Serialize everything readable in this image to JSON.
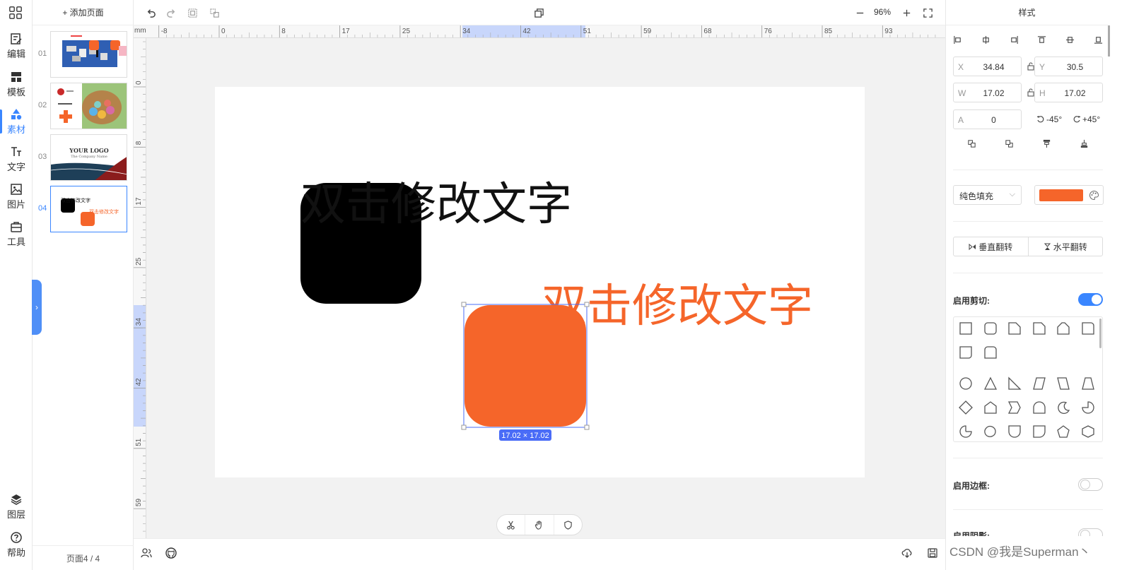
{
  "left_nav": {
    "items": [
      {
        "label": "编辑",
        "icon": "edit-icon"
      },
      {
        "label": "模板",
        "icon": "template-icon"
      },
      {
        "label": "素材",
        "icon": "shapes-icon",
        "active": true
      },
      {
        "label": "文字",
        "icon": "text-icon"
      },
      {
        "label": "图片",
        "icon": "image-icon"
      },
      {
        "label": "工具",
        "icon": "toolbox-icon"
      }
    ],
    "bottom_items": [
      {
        "label": "图层",
        "icon": "layers-icon"
      },
      {
        "label": "帮助",
        "icon": "help-icon"
      }
    ]
  },
  "pages_panel": {
    "add_page_label": "+ 添加页面",
    "pages": [
      {
        "num": "01"
      },
      {
        "num": "02"
      },
      {
        "num": "03",
        "logo_text": "YOUR LOGO",
        "company_text": "The Company Name"
      },
      {
        "num": "04",
        "active": true,
        "text_black": "双击修改文字",
        "text_orange": "双击修改文字"
      }
    ],
    "footer": "页面4 / 4"
  },
  "toolbar": {
    "zoom": "96%",
    "icons": [
      "undo-icon",
      "redo-icon",
      "group-icon",
      "ungroup-icon",
      "copy-icon",
      "zoom-out-icon",
      "zoom-in-icon",
      "fullscreen-icon"
    ]
  },
  "ruler": {
    "unit": "mm",
    "h_ticks": [
      "-8",
      "0",
      "8",
      "17",
      "25",
      "34",
      "42",
      "51",
      "59",
      "68",
      "76",
      "85",
      "93"
    ],
    "v_ticks": [
      "0",
      "8",
      "17",
      "25",
      "34",
      "42",
      "51",
      "59"
    ]
  },
  "canvas": {
    "black_text": "双击修改文字",
    "orange_text": "双击修改文字",
    "selection_size": "17.02 × 17.02",
    "colors": {
      "black_shape": "#000000",
      "orange_shape": "#f5652a",
      "selection": "#4a6cf7"
    }
  },
  "properties": {
    "header": "样式",
    "x": {
      "label": "X",
      "value": "34.84"
    },
    "y": {
      "label": "Y",
      "value": "30.5"
    },
    "w": {
      "label": "W",
      "value": "17.02"
    },
    "h": {
      "label": "H",
      "value": "17.02"
    },
    "a": {
      "label": "A",
      "value": "0"
    },
    "rotate_left": "-45°",
    "rotate_right": "+45°",
    "fill_type": "纯色填充",
    "fill_color": "#f5652a",
    "flip_vertical": "垂直翻转",
    "flip_horizontal": "水平翻转",
    "clip_label": "启用剪切:",
    "clip_enabled": true,
    "border_label": "启用边框:",
    "border_enabled": false,
    "shadow_label": "启用阴影:"
  },
  "watermark": "CSDN @我是Superman丶"
}
